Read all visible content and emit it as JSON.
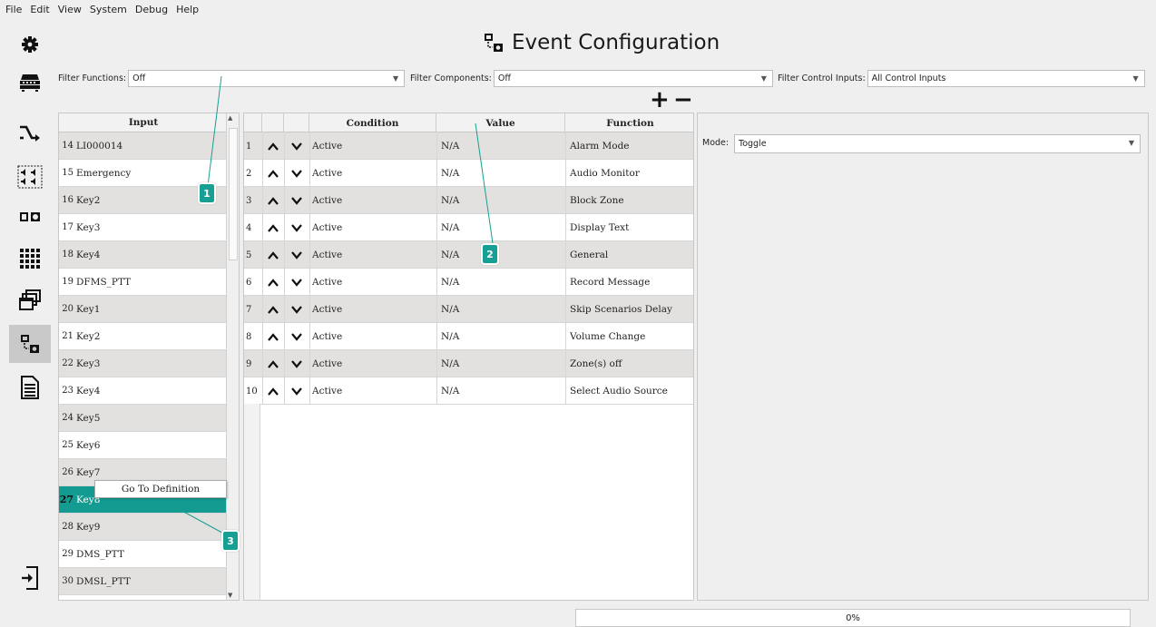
{
  "menu": [
    "File",
    "Edit",
    "View",
    "System",
    "Debug",
    "Help"
  ],
  "title": "Event Configuration",
  "filters": {
    "functions_label": "Filter Functions:",
    "functions_value": "Off",
    "components_label": "Filter Components:",
    "components_value": "Off",
    "control_inputs_label": "Filter Control Inputs:",
    "control_inputs_value": "All Control Inputs"
  },
  "add_symbol": "+",
  "remove_symbol": "−",
  "input_table": {
    "header": "Input",
    "rows": [
      {
        "num": "14",
        "label": "LI000014"
      },
      {
        "num": "15",
        "label": "Emergency"
      },
      {
        "num": "16",
        "label": "Key2"
      },
      {
        "num": "17",
        "label": "Key3"
      },
      {
        "num": "18",
        "label": "Key4"
      },
      {
        "num": "19",
        "label": "DFMS_PTT"
      },
      {
        "num": "20",
        "label": "Key1"
      },
      {
        "num": "21",
        "label": "Key2"
      },
      {
        "num": "22",
        "label": "Key3"
      },
      {
        "num": "23",
        "label": "Key4"
      },
      {
        "num": "24",
        "label": "Key5"
      },
      {
        "num": "25",
        "label": "Key6"
      },
      {
        "num": "26",
        "label": "Key7"
      },
      {
        "num": "27",
        "label": "Key8"
      },
      {
        "num": "28",
        "label": "Key9"
      },
      {
        "num": "29",
        "label": "DMS_PTT"
      },
      {
        "num": "30",
        "label": "DMSL_PTT"
      }
    ],
    "selected_index": 13
  },
  "context_menu": {
    "item": "Go To Definition"
  },
  "event_table": {
    "headers": {
      "condition": "Condition",
      "value": "Value",
      "function": "Function"
    },
    "rows": [
      {
        "num": "1",
        "condition": "Active",
        "value": "N/A",
        "function": "Alarm Mode"
      },
      {
        "num": "2",
        "condition": "Active",
        "value": "N/A",
        "function": "Audio Monitor"
      },
      {
        "num": "3",
        "condition": "Active",
        "value": "N/A",
        "function": "Block Zone"
      },
      {
        "num": "4",
        "condition": "Active",
        "value": "N/A",
        "function": "Display Text"
      },
      {
        "num": "5",
        "condition": "Active",
        "value": "N/A",
        "function": "General"
      },
      {
        "num": "6",
        "condition": "Active",
        "value": "N/A",
        "function": "Record Message"
      },
      {
        "num": "7",
        "condition": "Active",
        "value": "N/A",
        "function": "Skip Scenarios Delay"
      },
      {
        "num": "8",
        "condition": "Active",
        "value": "N/A",
        "function": "Volume Change"
      },
      {
        "num": "9",
        "condition": "Active",
        "value": "N/A",
        "function": "Zone(s) off"
      },
      {
        "num": "10",
        "condition": "Active",
        "value": "N/A",
        "function": "Select Audio Source"
      }
    ]
  },
  "mode": {
    "label": "Mode:",
    "value": "Toggle"
  },
  "progress": {
    "text": "0%",
    "value": 0
  },
  "callouts": [
    "1",
    "2",
    "3"
  ],
  "sidebar_icons": [
    "gear-icon",
    "network-device-icon",
    "routing-icon",
    "audio-channels-icon",
    "toggle-icon",
    "grid-icon",
    "windows-icon",
    "event-configuration-icon",
    "document-icon",
    "logout-icon"
  ],
  "colors": {
    "accent": "#149b91",
    "row_shade": "#e3e1df",
    "callout": "#169f92"
  }
}
